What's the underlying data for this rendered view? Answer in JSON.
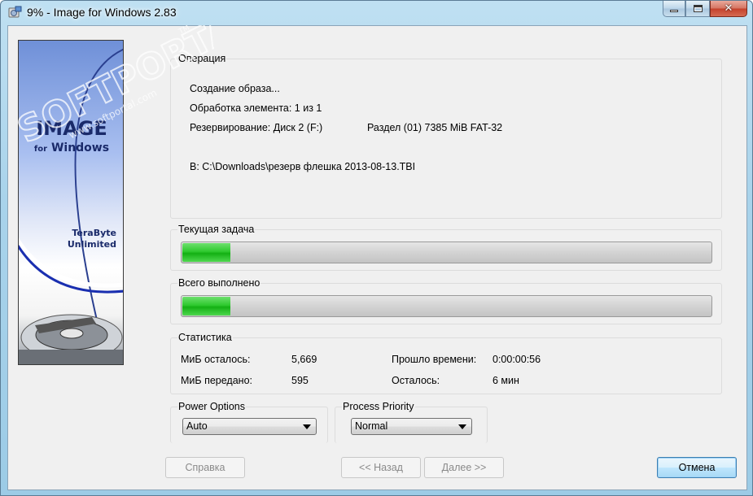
{
  "window": {
    "title": "9% - Image for Windows 2.83",
    "controls": {
      "minimize": "minimize-icon",
      "maximize": "maximize-icon",
      "close": "close-icon"
    }
  },
  "watermark": {
    "brand": "SOFTPORTAL",
    "url": "www.softportal.com",
    "tm": "TM"
  },
  "banner": {
    "title": "IMAGE",
    "subtitle_for": "for",
    "subtitle_windows": "Windows",
    "company_line1": "TeraByte",
    "company_line2": "Unlimited"
  },
  "operation": {
    "label": "Операция",
    "line1": "Создание образа...",
    "line2": "Обработка элемента: 1 из 1",
    "line3_left": "Резервирование: Диск 2 (F:)",
    "line3_right": "Раздел (01) 7385 MiB FAT-32",
    "line4": "В: C:\\Downloads\\резерв флешка 2013-08-13.TBI"
  },
  "current_task": {
    "label": "Текущая задача",
    "progress": 0.09
  },
  "total": {
    "label": "Всего выполнено",
    "progress": 0.09
  },
  "stats": {
    "label": "Статистика",
    "remaining_mib_label": "МиБ осталось:",
    "remaining_mib_value": "5,669",
    "transferred_mib_label": "МиБ передано:",
    "transferred_mib_value": "595",
    "elapsed_label": "Прошло времени:",
    "elapsed_value": "0:00:00:56",
    "left_label": "Осталось:",
    "left_value": "6 мин"
  },
  "power_options": {
    "label": "Power Options",
    "selected": "Auto"
  },
  "process_priority": {
    "label": "Process Priority",
    "selected": "Normal"
  },
  "buttons": {
    "help": "Справка",
    "back": "<< Назад",
    "next": "Далее >>",
    "cancel": "Отмена"
  },
  "colors": {
    "progress_fill": "#2fc92f",
    "banner_blue": "#1a2a6a",
    "default_button_border": "#3c7fb1"
  }
}
